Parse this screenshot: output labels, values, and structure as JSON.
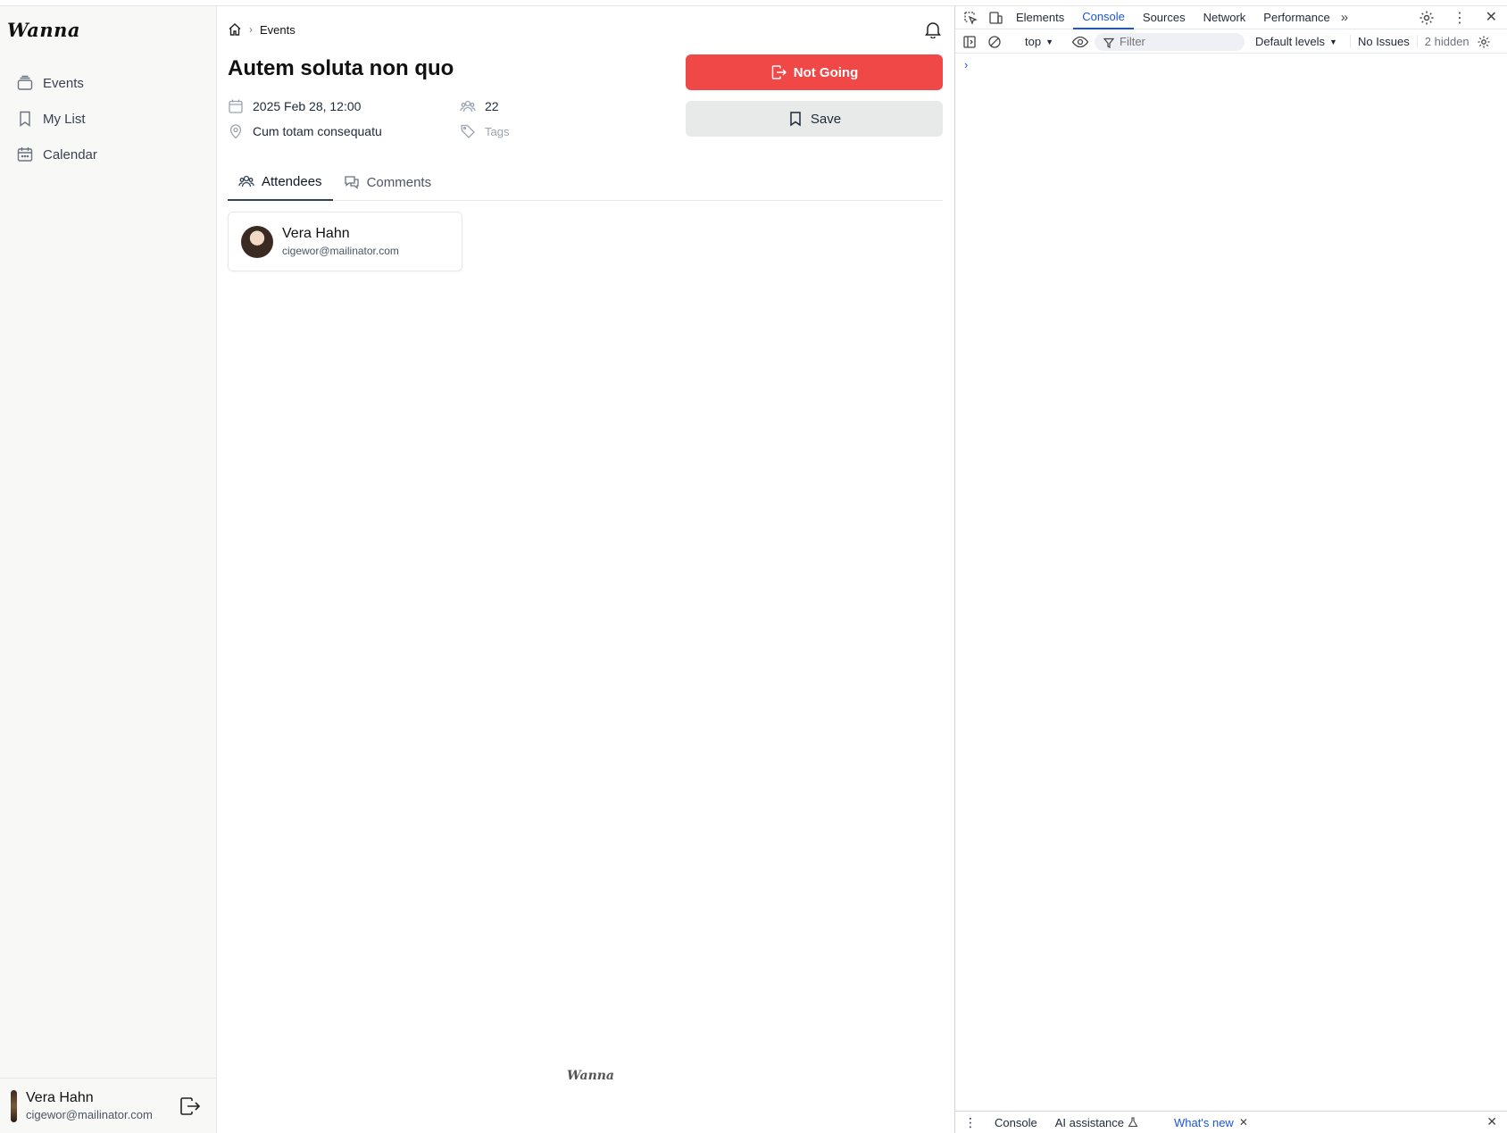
{
  "app": {
    "logo": "Wanna",
    "footer_logo": "Wanna"
  },
  "sidebar": {
    "items": [
      {
        "label": "Events",
        "icon": "stack-icon"
      },
      {
        "label": "My List",
        "icon": "bookmark-icon"
      },
      {
        "label": "Calendar",
        "icon": "calendar-icon"
      }
    ],
    "user": {
      "name": "Vera Hahn",
      "email": "cigewor@mailinator.com"
    }
  },
  "breadcrumb": {
    "current": "Events"
  },
  "event": {
    "title": "Autem soluta non quo",
    "date": "2025 Feb 28, 12:00",
    "location": "Cum totam consequatu",
    "attendee_count": "22",
    "tags_placeholder": "Tags"
  },
  "actions": {
    "not_going": "Not Going",
    "save": "Save"
  },
  "tabs": [
    {
      "label": "Attendees",
      "active": true
    },
    {
      "label": "Comments",
      "active": false
    }
  ],
  "attendees": [
    {
      "name": "Vera Hahn",
      "email": "cigewor@mailinator.com"
    }
  ],
  "devtools": {
    "tabs": [
      "Elements",
      "Console",
      "Sources",
      "Network",
      "Performance"
    ],
    "active_tab": "Console",
    "context": "top",
    "filter_placeholder": "Filter",
    "levels": "Default levels",
    "issues": "No Issues",
    "hidden": "2 hidden",
    "prompt": "›",
    "drawer": {
      "console": "Console",
      "ai": "AI assistance",
      "whats_new": "What's new"
    }
  },
  "colors": {
    "danger": "#f04747",
    "accent": "#1a56db",
    "sidebar_bg": "#f8f8f7"
  }
}
